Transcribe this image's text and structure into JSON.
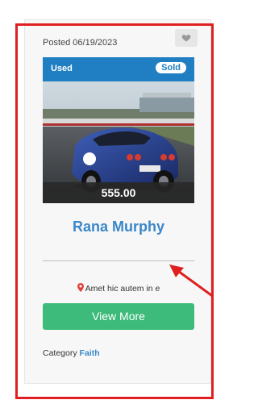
{
  "listing": {
    "posted_label": "Posted 06/19/2023",
    "used_label": "Used",
    "sold_label": "Sold",
    "price": "555.00",
    "title": "Rana Murphy",
    "location": "Amet hic autem in e",
    "view_more_label": "View More",
    "category_prefix": "Category",
    "category_value": "Faith"
  },
  "icons": {
    "favorite": "heart-icon",
    "location": "map-pin-icon",
    "annotation": "arrow-icon"
  },
  "colors": {
    "accent_blue": "#1f7fc2",
    "title_blue": "#3a87c9",
    "button_green": "#3dbb7a",
    "highlight_red": "#e02020"
  }
}
